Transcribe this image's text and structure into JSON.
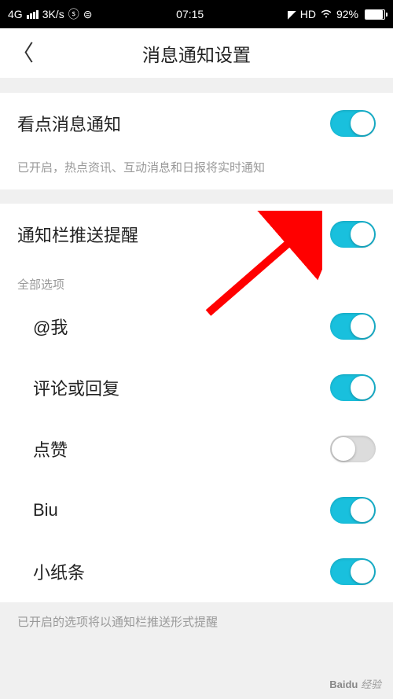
{
  "statusBar": {
    "network": "4G",
    "speed": "3K/s",
    "speedIcon": "ⓢ",
    "dataIcon": "ⓢ",
    "time": "07:15",
    "hd": "HD",
    "battery": "92%"
  },
  "header": {
    "title": "消息通知设置"
  },
  "mainToggle": {
    "label": "看点消息通知",
    "hint": "已开启，热点资讯、互动消息和日报将实时通知"
  },
  "pushToggle": {
    "label": "通知栏推送提醒"
  },
  "sectionLabel": "全部选项",
  "options": [
    {
      "label": "@我",
      "on": true
    },
    {
      "label": "评论或回复",
      "on": true
    },
    {
      "label": "点赞",
      "on": false
    },
    {
      "label": "Biu",
      "on": true
    },
    {
      "label": "小纸条",
      "on": true
    }
  ],
  "bottomHint": "已开启的选项将以通知栏推送形式提醒",
  "watermark": "Baidu 经验"
}
